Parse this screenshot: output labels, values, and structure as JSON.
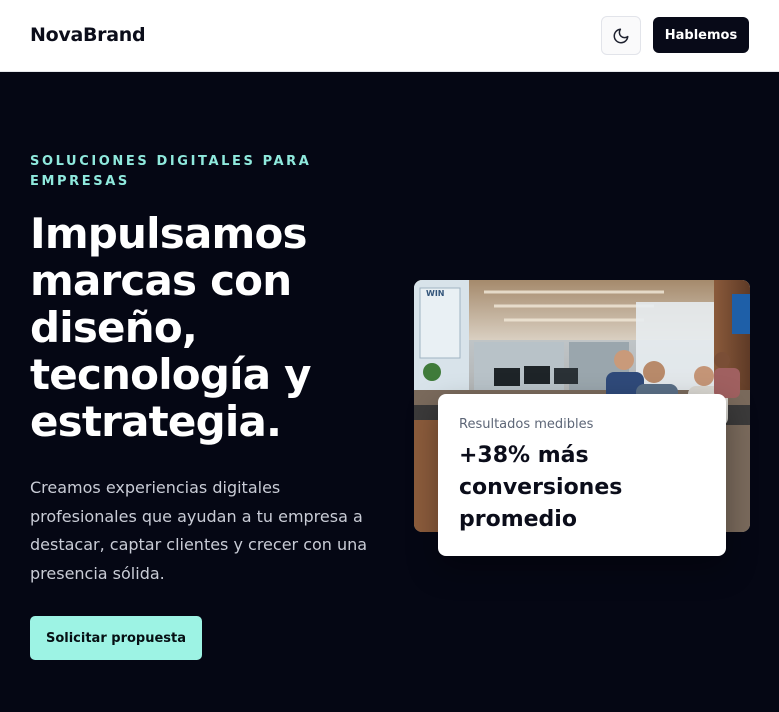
{
  "header": {
    "brand": "NovaBrand",
    "theme_toggle_icon": "moon-icon",
    "cta_label": "Hablemos"
  },
  "hero": {
    "eyebrow": "SOLUCIONES DIGITALES PARA EMPRESAS",
    "headline": "Impulsamos marcas con diseño, tecnología y estrategia.",
    "lead": "Creamos experiencias digitales profesionales que ayudan a tu empresa a destacar, captar clientes y crecer con una presencia sólida.",
    "cta_label": "Solicitar propuesta"
  },
  "stat_card": {
    "label": "Resultados medibles",
    "value": "+38% más conversiones promedio"
  },
  "photo": {
    "description_icon": "office-team-photo"
  },
  "colors": {
    "accent": "#9df3e4",
    "eyebrow": "#8fe9dd",
    "hero_bg": "#050714",
    "dark_button": "#080a18"
  }
}
